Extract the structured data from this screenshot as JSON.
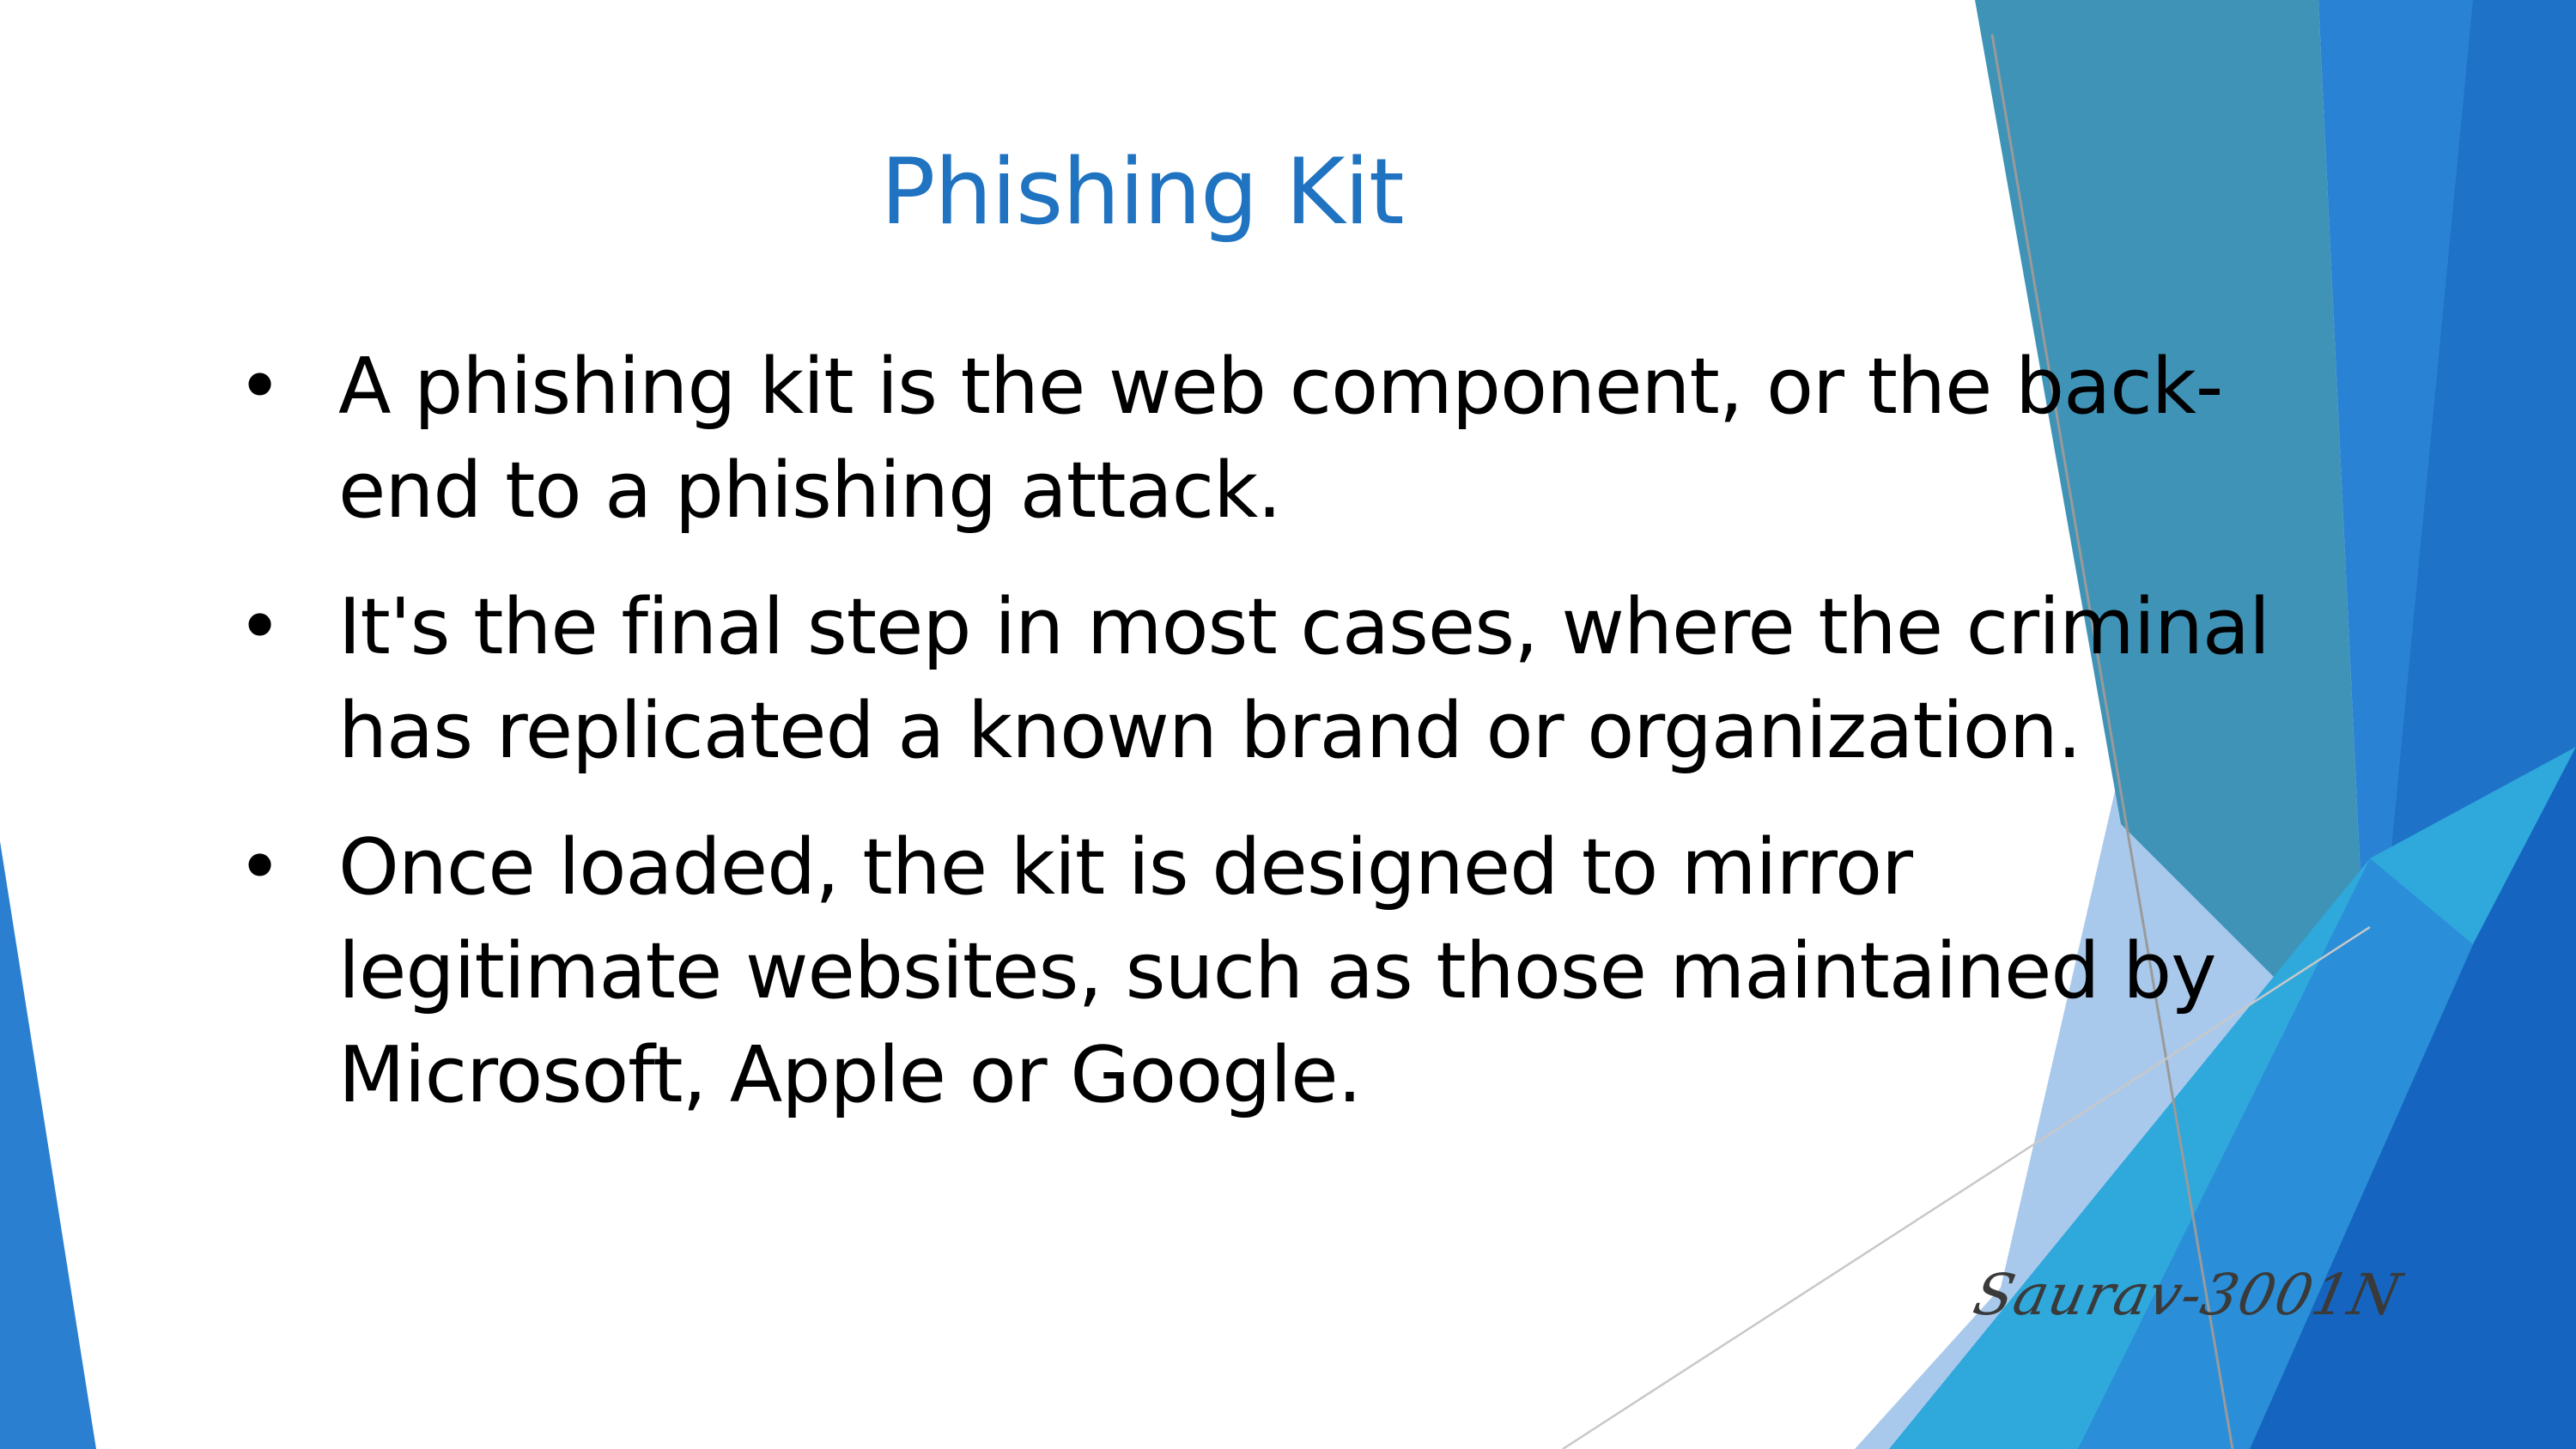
{
  "slide": {
    "title": "Phishing Kit",
    "bullets": [
      {
        "line1": "A phishing kit is the web component, or the back-",
        "line2": "end to a phishing attack."
      },
      {
        "line1": "It's the final step in most cases, where the criminal",
        "line2": "has replicated a known brand or organization."
      },
      {
        "line1": "Once loaded, the kit is designed to mirror",
        "line2": "legitimate websites, such as those maintained by",
        "line3": "Microsoft,  Apple or Google."
      }
    ],
    "bullet_glyph": "•",
    "signature": "Saurav-3001N"
  },
  "theme": {
    "title_color": "#1f73c1",
    "text_color": "#000000",
    "accent_dark_blue": "#1565c0",
    "accent_blue": "#2a82d4",
    "accent_teal": "#3f93a8",
    "accent_cyan": "#2fa8dc",
    "accent_light_blue": "#a9c9ec"
  }
}
